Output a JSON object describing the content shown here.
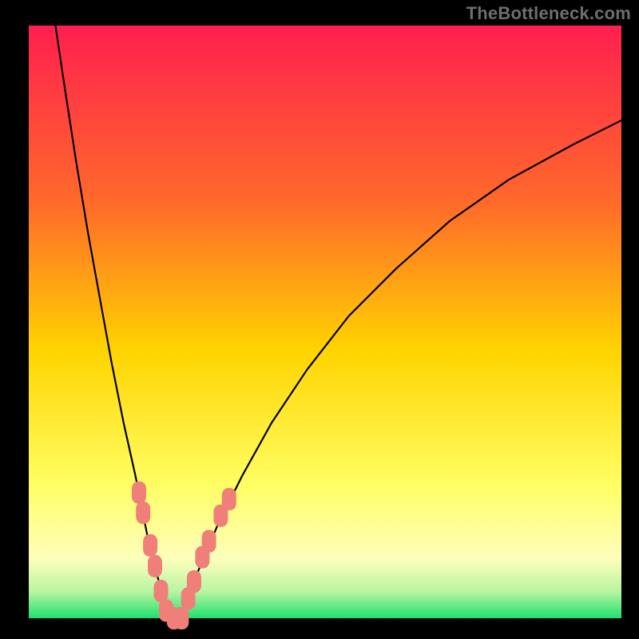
{
  "watermark": {
    "text": "TheBottleneck.com"
  },
  "chart_data": {
    "type": "line",
    "title": "",
    "xlabel": "",
    "ylabel": "",
    "xlim": [
      0,
      100
    ],
    "ylim": [
      0,
      100
    ],
    "grid": false,
    "legend": false,
    "background_gradient": {
      "stops": [
        {
          "offset": 0.0,
          "color": "#ff1f4f"
        },
        {
          "offset": 0.3,
          "color": "#ff6a2a"
        },
        {
          "offset": 0.55,
          "color": "#ffd400"
        },
        {
          "offset": 0.78,
          "color": "#ffff66"
        },
        {
          "offset": 0.9,
          "color": "#fdfebc"
        },
        {
          "offset": 0.955,
          "color": "#b8f5a0"
        },
        {
          "offset": 1.0,
          "color": "#20e070"
        }
      ]
    },
    "series": [
      {
        "name": "left-arm",
        "x": [
          4.5,
          6,
          8,
          10,
          12,
          14,
          16,
          18,
          20,
          21,
          22,
          23,
          23.8
        ],
        "y": [
          100,
          90,
          77,
          65,
          54,
          43,
          33,
          24,
          14,
          10,
          6,
          3,
          0
        ]
      },
      {
        "name": "right-arm",
        "x": [
          25.5,
          27,
          29,
          32,
          36,
          41,
          47,
          54,
          62,
          71,
          81,
          92,
          100
        ],
        "y": [
          0,
          4,
          9,
          16,
          24,
          33,
          42,
          51,
          59,
          67,
          74,
          80,
          84
        ]
      }
    ],
    "markers": {
      "color": "#ef7f78",
      "points": [
        {
          "x": 18.6,
          "y": 21.2
        },
        {
          "x": 19.3,
          "y": 17.8
        },
        {
          "x": 20.5,
          "y": 12.3
        },
        {
          "x": 21.3,
          "y": 8.8
        },
        {
          "x": 22.3,
          "y": 4.6
        },
        {
          "x": 23.2,
          "y": 1.3
        },
        {
          "x": 24.5,
          "y": 0.0
        },
        {
          "x": 25.8,
          "y": 0.0
        },
        {
          "x": 26.9,
          "y": 3.3
        },
        {
          "x": 27.9,
          "y": 6.2
        },
        {
          "x": 29.3,
          "y": 10.3
        },
        {
          "x": 30.4,
          "y": 13.0
        },
        {
          "x": 32.4,
          "y": 17.3
        },
        {
          "x": 33.8,
          "y": 20.1
        }
      ]
    }
  }
}
